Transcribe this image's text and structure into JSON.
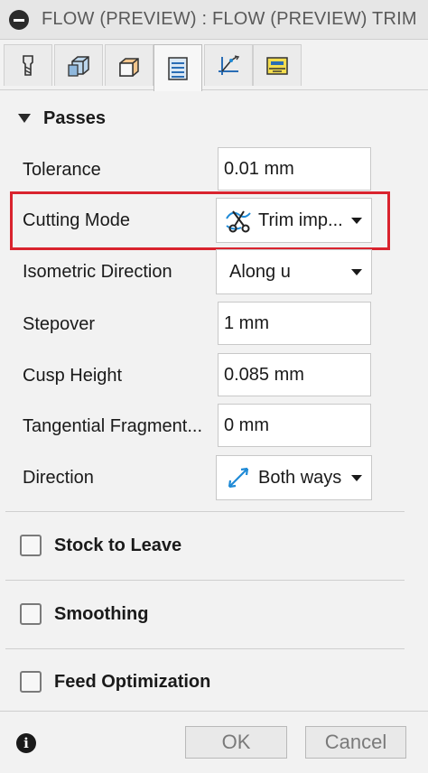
{
  "window": {
    "title": "FLOW (PREVIEW) : FLOW (PREVIEW) TRIM"
  },
  "tabs": [
    {
      "icon": "tool-icon"
    },
    {
      "icon": "geometry-icon"
    },
    {
      "icon": "heights-icon"
    },
    {
      "icon": "passes-icon",
      "active": true
    },
    {
      "icon": "linking-icon"
    },
    {
      "icon": "post-process-icon"
    }
  ],
  "passes": {
    "title": "Passes",
    "tolerance": {
      "label": "Tolerance",
      "value": "0.01 mm"
    },
    "cutting_mode": {
      "label": "Cutting Mode",
      "value": "Trim imp..."
    },
    "isometric_direction": {
      "label": "Isometric Direction",
      "value": "Along u"
    },
    "stepover": {
      "label": "Stepover",
      "value": "1 mm"
    },
    "cusp_height": {
      "label": "Cusp Height",
      "value": "0.085 mm"
    },
    "tangential_fragment": {
      "label": "Tangential Fragment...",
      "value": "0 mm"
    },
    "direction": {
      "label": "Direction",
      "value": "Both ways"
    }
  },
  "groups": {
    "stock_to_leave": "Stock to Leave",
    "smoothing": "Smoothing",
    "feed_optimization": "Feed Optimization"
  },
  "footer": {
    "ok": "OK",
    "cancel": "Cancel"
  },
  "colors": {
    "highlight": "#d9232e",
    "accent": "#1f8ad6"
  }
}
